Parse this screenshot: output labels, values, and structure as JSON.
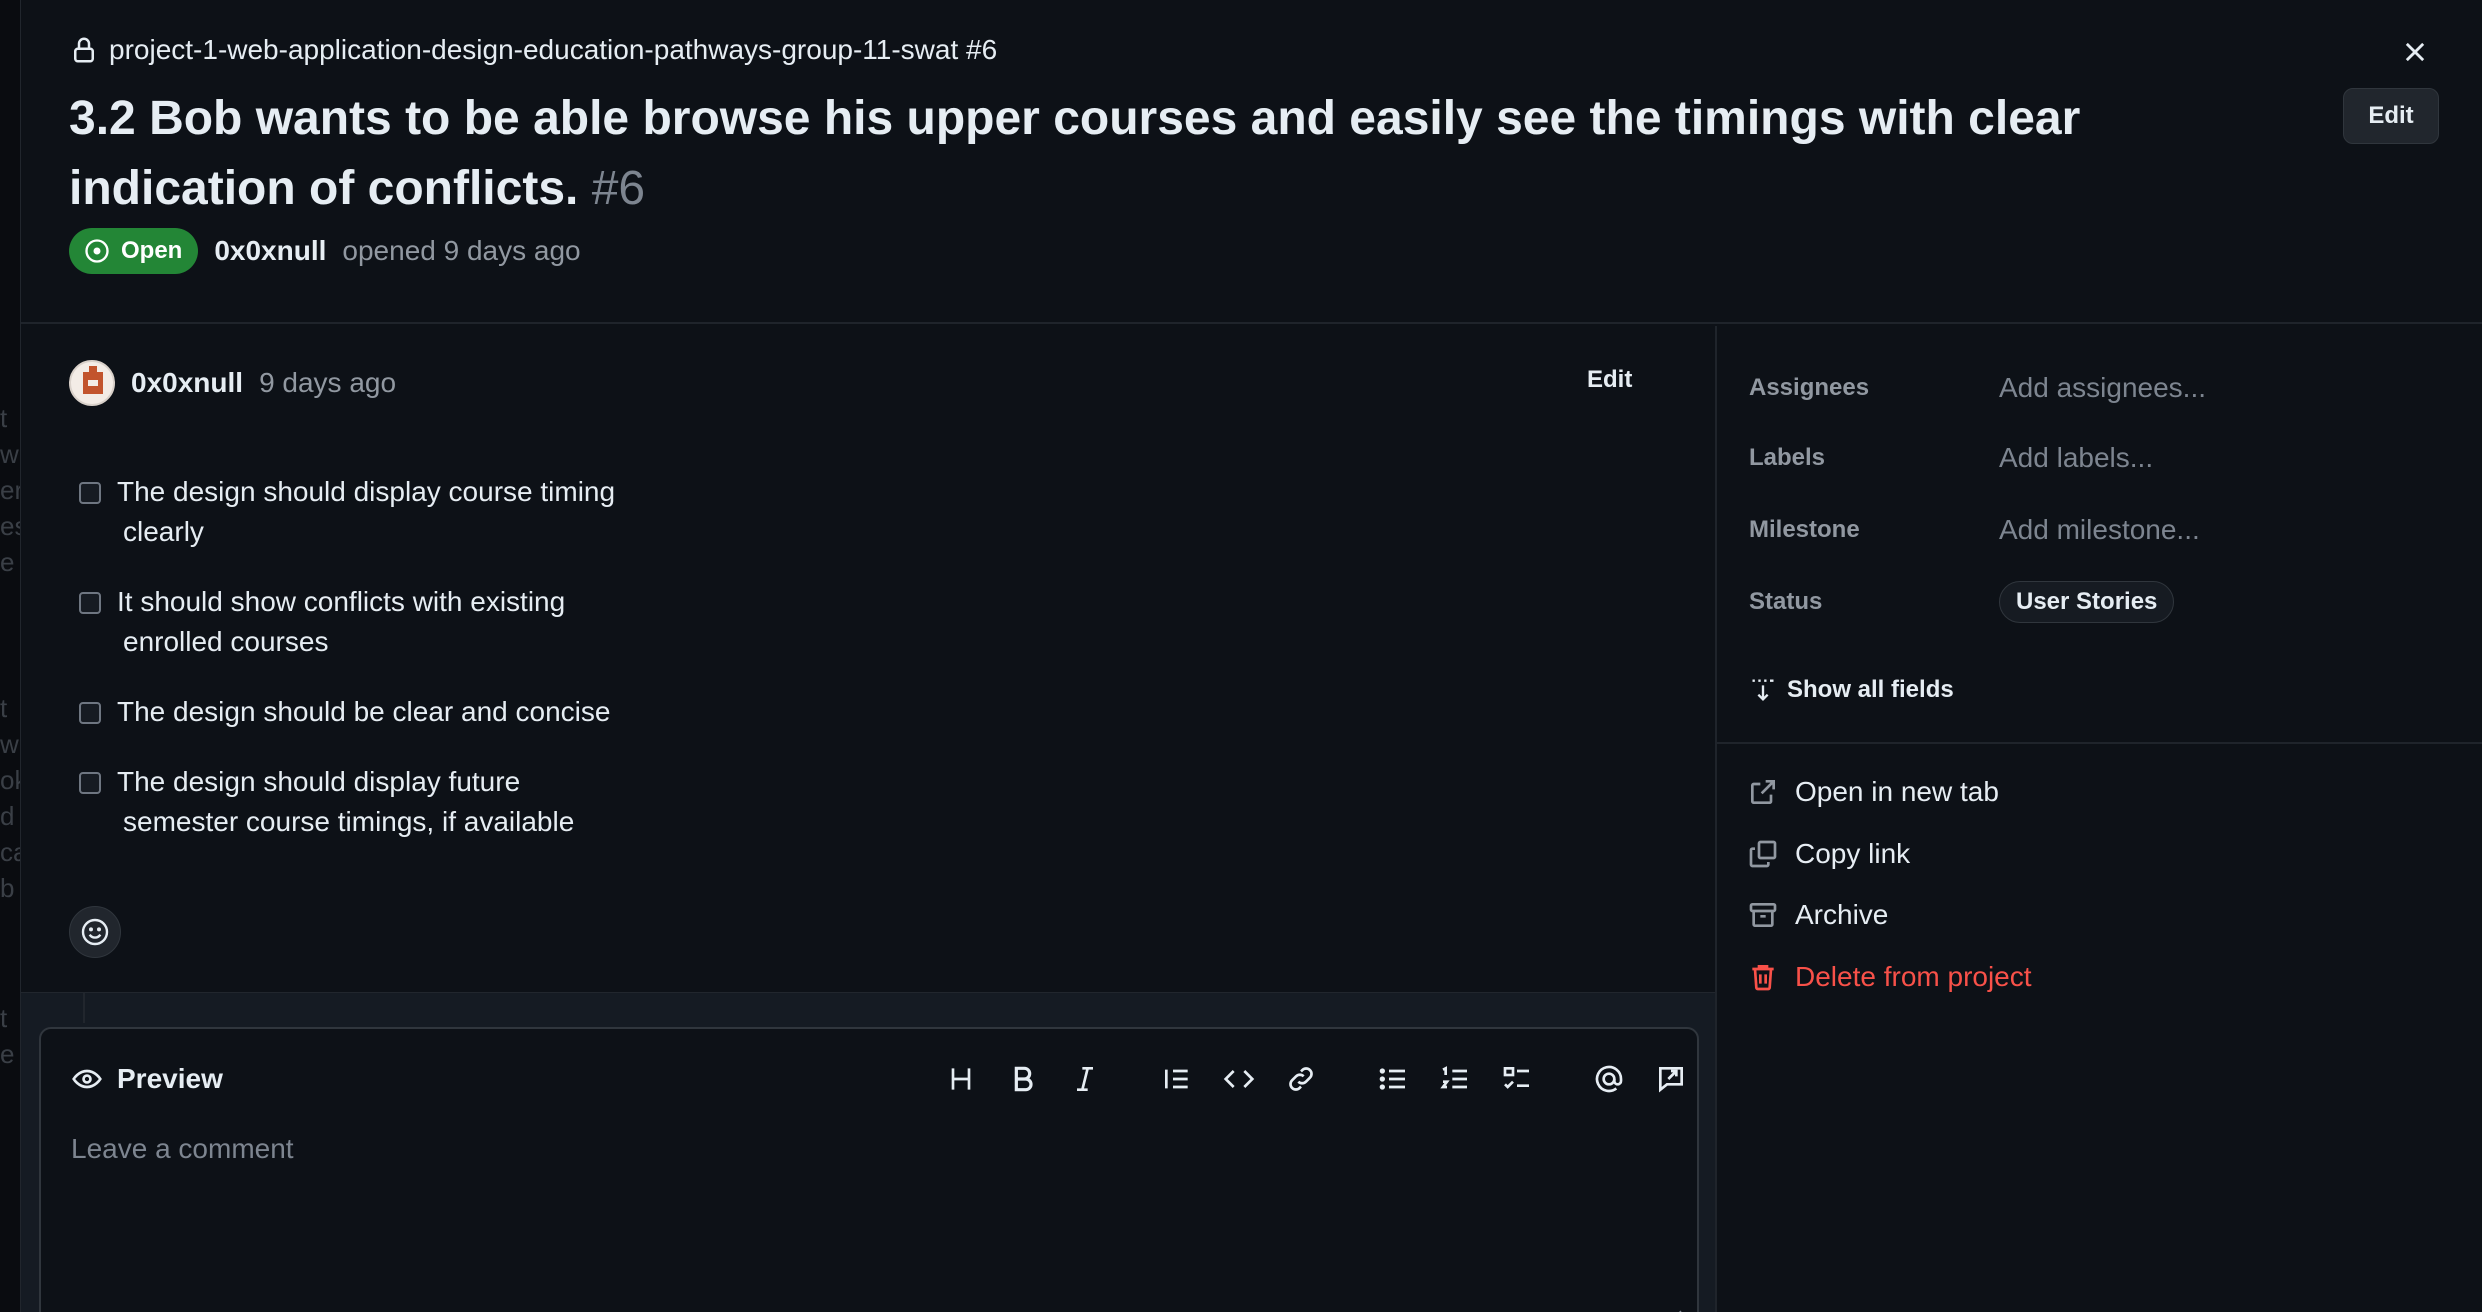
{
  "header": {
    "repo_line": "project-1-web-application-design-education-pathways-group-11-swat #6",
    "title": "3.2 Bob wants to be able browse his upper courses and easily see the timings with clear indication of conflicts.",
    "issue_number": "#6",
    "edit_label": "Edit",
    "state_label": "Open",
    "author": "0x0xnull",
    "opened_text": "opened 9 days ago"
  },
  "comment": {
    "author": "0x0xnull",
    "time": "9 days ago",
    "edit_label": "Edit",
    "tasks": [
      {
        "line1": "The design should display course timing",
        "line2": "clearly"
      },
      {
        "line1": "It should show conflicts with existing",
        "line2": "enrolled courses"
      },
      {
        "line1": "The design should be clear and concise",
        "line2": ""
      },
      {
        "line1": "The design should display future",
        "line2": "semester course timings, if available"
      }
    ]
  },
  "composer": {
    "preview_label": "Preview",
    "placeholder": "Leave a comment",
    "toolbar_icons": [
      "heading-icon",
      "bold-icon",
      "italic-icon",
      "quote-icon",
      "code-icon",
      "link-icon",
      "unordered-list-icon",
      "ordered-list-icon",
      "task-list-icon",
      "mention-icon",
      "reference-icon"
    ]
  },
  "sidebar": {
    "fields": [
      {
        "label": "Assignees",
        "value": "Add assignees..."
      },
      {
        "label": "Labels",
        "value": "Add labels..."
      },
      {
        "label": "Milestone",
        "value": "Add milestone..."
      },
      {
        "label": "Status",
        "value": "User Stories"
      }
    ],
    "show_all_label": "Show all fields",
    "actions": [
      {
        "label": "Open in new tab",
        "icon": "external-link-icon"
      },
      {
        "label": "Copy link",
        "icon": "copy-icon"
      },
      {
        "label": "Archive",
        "icon": "archive-icon"
      },
      {
        "label": "Delete from project",
        "icon": "trash-icon"
      }
    ]
  },
  "colors": {
    "background": "#0d1117",
    "open_badge": "#238636",
    "danger": "#f85149",
    "muted_text": "#9198a1"
  }
}
